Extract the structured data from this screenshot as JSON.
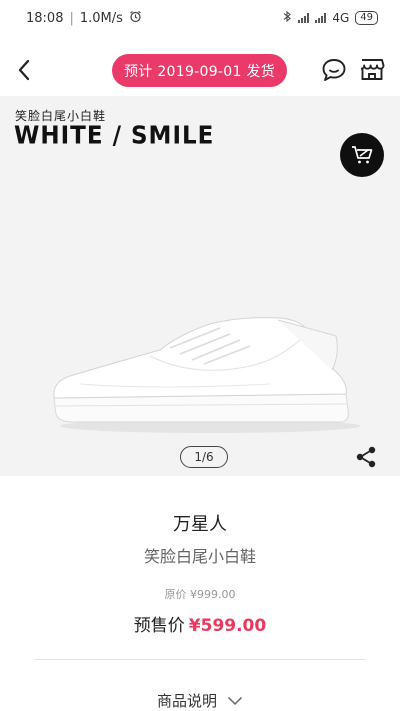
{
  "status_bar": {
    "time": "18:08",
    "speed": "1.0M/s",
    "network": "4G",
    "battery": "49"
  },
  "nav": {
    "ship_notice": "预计 2019-09-01 发货"
  },
  "gallery": {
    "brand_cn": "笑脸白尾小白鞋",
    "brand_en": "WHITE / SMILE",
    "counter": "1/6"
  },
  "product": {
    "brand": "万星人",
    "name": "笑脸白尾小白鞋",
    "original_price": "原价 ¥999.00",
    "presale_label": "预售价",
    "presale_price": "¥599.00"
  },
  "tabs": {
    "description": "商品说明"
  },
  "colors": {
    "accent": "#ea3a6a",
    "price": "#e8395e"
  },
  "icons": [
    "back-icon",
    "chat-icon",
    "shop-icon",
    "cart-icon",
    "share-icon",
    "chevron-down-icon",
    "alarm-icon",
    "bluetooth-icon",
    "signal-icon",
    "battery-icon"
  ]
}
